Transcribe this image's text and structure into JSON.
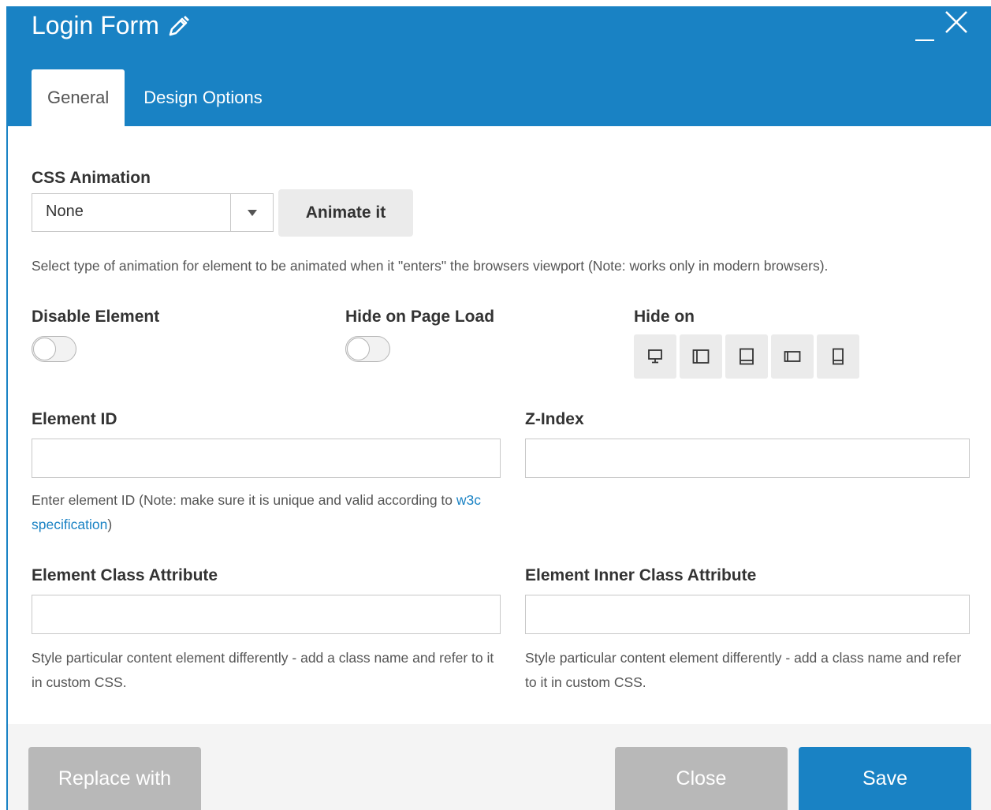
{
  "window": {
    "title": "Login Form"
  },
  "tabs": [
    {
      "label": "General",
      "active": true
    },
    {
      "label": "Design Options",
      "active": false
    }
  ],
  "css_animation": {
    "label": "CSS Animation",
    "selected": "None",
    "animate_button": "Animate it",
    "help": "Select type of animation for element to be animated when it \"enters\" the browsers viewport (Note: works only in modern browsers)."
  },
  "disable_element": {
    "label": "Disable Element",
    "on": false
  },
  "hide_on_page_load": {
    "label": "Hide on Page Load",
    "on": false
  },
  "hide_on": {
    "label": "Hide on",
    "devices": [
      "desktop-icon",
      "tablet-landscape-icon",
      "tablet-portrait-icon",
      "mobile-landscape-icon",
      "mobile-portrait-icon"
    ]
  },
  "element_id": {
    "label": "Element ID",
    "value": "",
    "help_prefix": "Enter element ID (Note: make sure it is unique and valid according to ",
    "help_link": "w3c specification",
    "help_suffix": ")"
  },
  "z_index": {
    "label": "Z-Index",
    "value": ""
  },
  "element_class": {
    "label": "Element Class Attribute",
    "value": "",
    "help": "Style particular content element differently - add a class name and refer to it in custom CSS."
  },
  "element_inner_class": {
    "label": "Element Inner Class Attribute",
    "value": "",
    "help": "Style particular content element differently - add a class name and refer to it in custom CSS."
  },
  "footer": {
    "replace_label": "Replace with",
    "close_label": "Close",
    "save_label": "Save"
  },
  "colors": {
    "accent": "#1982c4",
    "button_grey": "#b8b8b8",
    "panel_grey": "#ebebeb"
  }
}
